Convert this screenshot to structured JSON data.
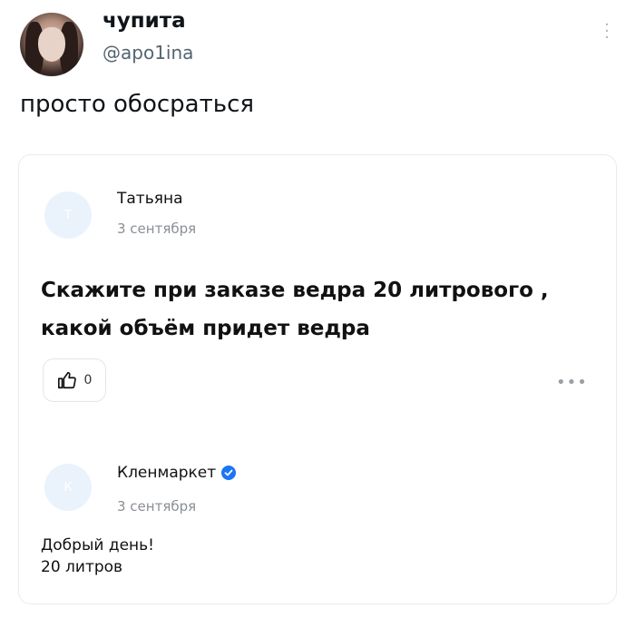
{
  "post": {
    "author_name": "чупита",
    "author_handle": "@apo1ina",
    "text": "просто обосраться"
  },
  "card": {
    "question": {
      "avatar_letter": "Т",
      "author": "Татьяна",
      "date": "3 сентября",
      "text": "Скажите при заказе ведра 20 литрового , какой объём придет ведра",
      "likes": "0"
    },
    "answer": {
      "avatar_letter": "К",
      "author": "Кленмаркет",
      "date": "3 сентября",
      "line1": "Добрый день!",
      "line2": "20 литров"
    }
  },
  "colors": {
    "verified_badge": "#1d74f5",
    "avatar_placeholder": "#eaf3fb"
  }
}
